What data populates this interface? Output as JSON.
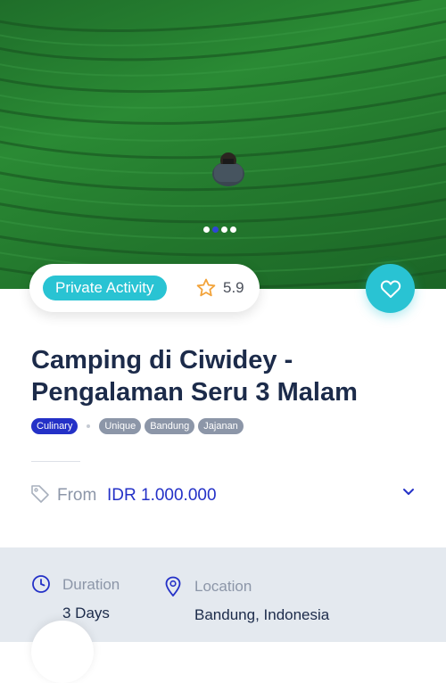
{
  "hero": {
    "image": "tea-plantation-photographer",
    "carousel_dots": 4,
    "active_dot": 1
  },
  "badge": {
    "label": "Private Activity",
    "color": "#29c3d3"
  },
  "rating": {
    "value": "5.9",
    "icon": "star-outline-icon"
  },
  "favorite": {
    "icon": "heart-outline-icon",
    "color": "#29c3d3"
  },
  "listing": {
    "title_line1": "Camping di Ciwidey -",
    "title_line2": "Pengalaman Seru 3 Malam",
    "tags": [
      "Culinary",
      "Unique",
      "Bandung",
      "Jajanan"
    ],
    "primary_tag_color": "#2431c7"
  },
  "price": {
    "icon": "price-tag-icon",
    "from_label": "From",
    "value": "IDR 1.000.000",
    "color": "#2431c7"
  },
  "details": {
    "duration_label": "Duration",
    "duration_value": "3 Days",
    "location_label": "Location",
    "location_value": "Bandung, Indonesia"
  }
}
